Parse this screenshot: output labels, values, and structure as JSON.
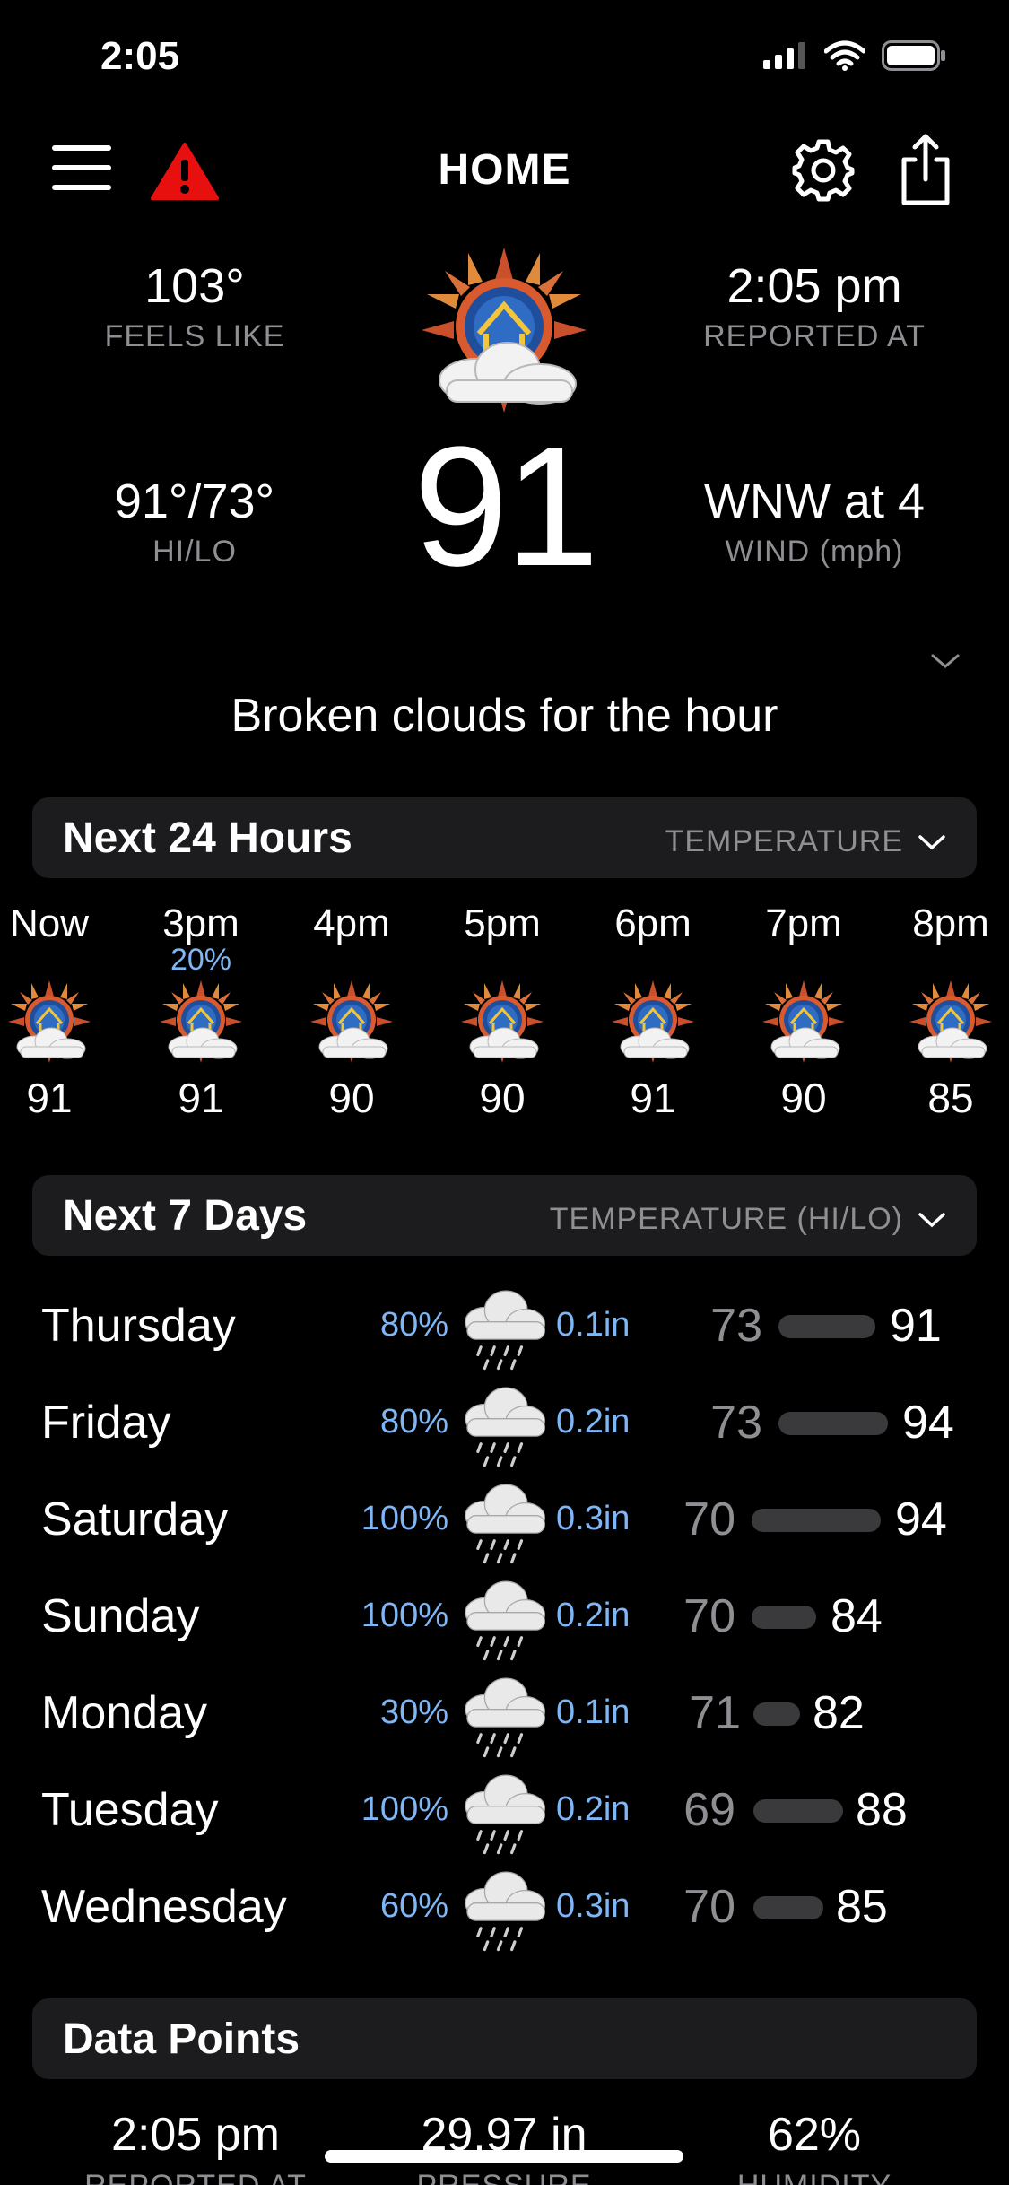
{
  "status_bar": {
    "time": "2:05"
  },
  "nav": {
    "title": "HOME"
  },
  "current": {
    "feels_like": {
      "value": "103°",
      "label": "FEELS LIKE"
    },
    "reported_at": {
      "value": "2:05 pm",
      "label": "REPORTED AT"
    },
    "hilo": {
      "value": "91°/73°",
      "label": "HI/LO"
    },
    "wind": {
      "value": "WNW at 4",
      "label": "WIND (mph)"
    },
    "temperature": "91",
    "summary": "Broken clouds for the hour"
  },
  "hourly": {
    "title": "Next 24 Hours",
    "selector": "TEMPERATURE",
    "hours": [
      {
        "time": "Now",
        "pop": "",
        "temp": "91"
      },
      {
        "time": "3pm",
        "pop": "20%",
        "temp": "91"
      },
      {
        "time": "4pm",
        "pop": "",
        "temp": "90"
      },
      {
        "time": "5pm",
        "pop": "",
        "temp": "90"
      },
      {
        "time": "6pm",
        "pop": "",
        "temp": "91"
      },
      {
        "time": "7pm",
        "pop": "",
        "temp": "90"
      },
      {
        "time": "8pm",
        "pop": "",
        "temp": "85"
      }
    ]
  },
  "daily": {
    "title": "Next 7 Days",
    "selector": "TEMPERATURE (HI/LO)",
    "days": [
      {
        "name": "Thursday",
        "pop": "80%",
        "precip": "0.1in",
        "lo": "73",
        "hi": "91"
      },
      {
        "name": "Friday",
        "pop": "80%",
        "precip": "0.2in",
        "lo": "73",
        "hi": "94"
      },
      {
        "name": "Saturday",
        "pop": "100%",
        "precip": "0.3in",
        "lo": "70",
        "hi": "94"
      },
      {
        "name": "Sunday",
        "pop": "100%",
        "precip": "0.2in",
        "lo": "70",
        "hi": "84"
      },
      {
        "name": "Monday",
        "pop": "30%",
        "precip": "0.1in",
        "lo": "71",
        "hi": "82"
      },
      {
        "name": "Tuesday",
        "pop": "100%",
        "precip": "0.2in",
        "lo": "69",
        "hi": "88"
      },
      {
        "name": "Wednesday",
        "pop": "60%",
        "precip": "0.3in",
        "lo": "70",
        "hi": "85"
      }
    ]
  },
  "data_points": {
    "title": "Data Points",
    "items": [
      {
        "value": "2:05 pm",
        "label": "REPORTED AT"
      },
      {
        "value": "29.97 in",
        "label": "PRESSURE"
      },
      {
        "value": "62%",
        "label": "HUMIDITY"
      }
    ]
  },
  "colors": {
    "alert": "#e8100e",
    "precip": "#7fb6f5",
    "muted": "#8e8e93",
    "panel": "#1c1c1e"
  },
  "icons": [
    "menu-icon",
    "alert-triangle-icon",
    "gear-icon",
    "share-icon",
    "sun-cloud-icon",
    "rain-cloud-icon",
    "chevron-down-icon"
  ]
}
